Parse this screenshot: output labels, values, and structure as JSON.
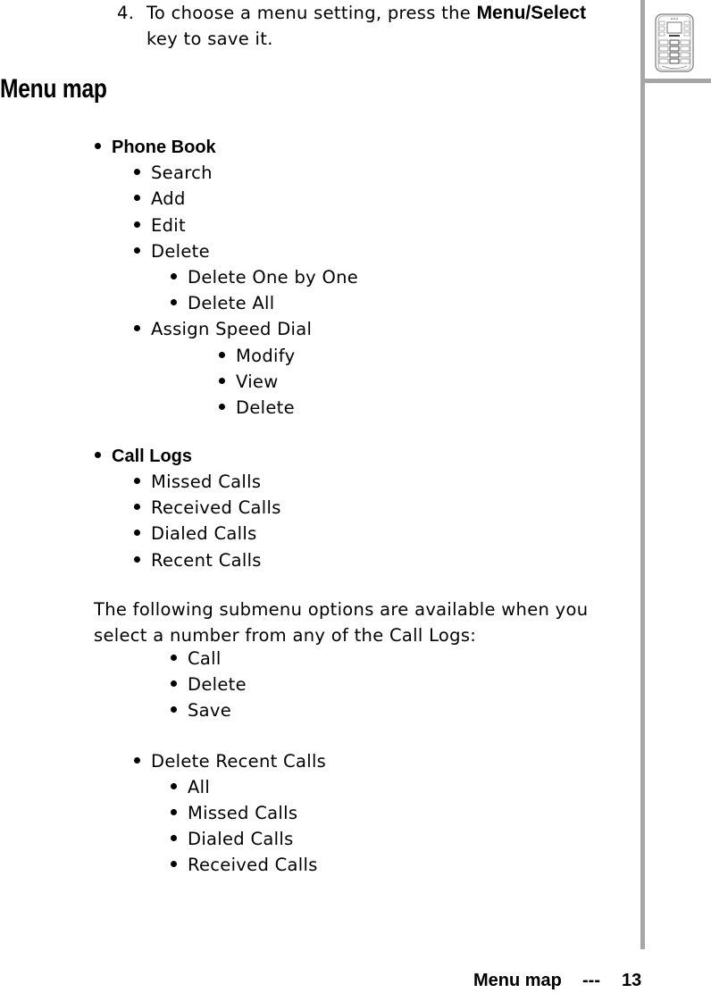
{
  "step": {
    "number": "4.",
    "text_before": "To choose a menu setting, press the ",
    "key_label": "Menu/Select",
    "text_after": " key to save it."
  },
  "heading": "Menu map",
  "phone_book": {
    "label": "Phone Book",
    "items": [
      "Search",
      "Add",
      "Edit",
      "Delete"
    ],
    "delete_sub": [
      "Delete One by One",
      "Delete All"
    ],
    "speed_dial": "Assign Speed Dial",
    "speed_dial_sub": [
      "Modify",
      "View",
      "Delete"
    ]
  },
  "call_logs": {
    "label": "Call Logs",
    "items": [
      "Missed Calls",
      "Received Calls",
      "Dialed Calls",
      "Recent Calls"
    ],
    "note": "The following submenu options are available when you select a number from any of the Call Logs:",
    "submenu": [
      "Call",
      "Delete",
      "Save"
    ],
    "delete_recent": "Delete Recent Calls",
    "delete_recent_sub": [
      "All",
      "Missed Calls",
      "Dialed Calls",
      "Received Calls"
    ]
  },
  "footer": {
    "section": "Menu map",
    "separator": "---",
    "page": "13"
  }
}
